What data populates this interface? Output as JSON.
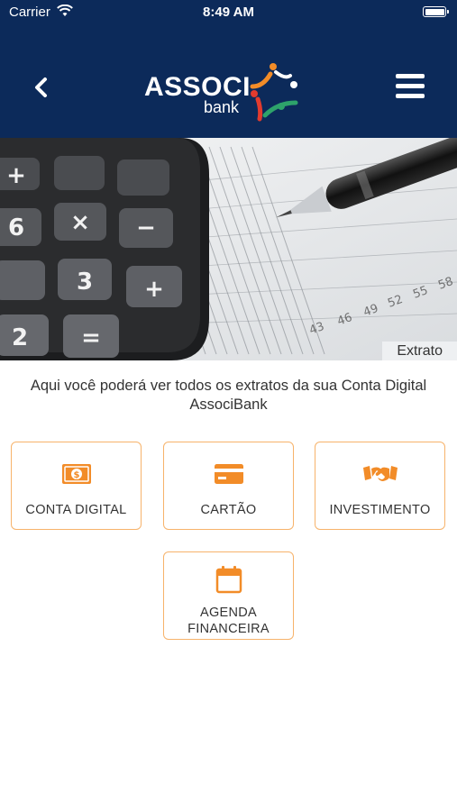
{
  "status_bar": {
    "carrier": "Carrier",
    "time": "8:49 AM"
  },
  "header": {
    "logo_text": "ASSOCI",
    "logo_sub": "bank",
    "colors": {
      "background": "#0c2a5a"
    }
  },
  "banner": {
    "caption": "Extrato"
  },
  "intro": {
    "text": "Aqui você poderá ver todos os extratos da sua Conta Digital AssociBank"
  },
  "cards": [
    {
      "label": "CONTA DIGITAL",
      "icon": "banknote-icon"
    },
    {
      "label": "CARTÃO",
      "icon": "credit-card-icon"
    },
    {
      "label": "INVESTIMENTO",
      "icon": "handshake-icon"
    },
    {
      "label": "AGENDA FINANCEIRA",
      "icon": "calendar-icon"
    }
  ],
  "colors": {
    "accent": "#f28c28",
    "card_border": "#f7b36b",
    "text": "#333333"
  }
}
